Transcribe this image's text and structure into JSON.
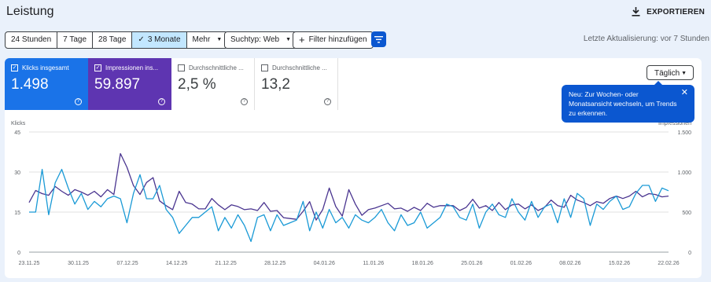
{
  "page": {
    "title": "Leistung"
  },
  "toolbar": {
    "export_label": "EXPORTIEREN",
    "export_icon": "download-icon"
  },
  "filters": {
    "ranges": [
      "24 Stunden",
      "7 Tage",
      "28 Tage",
      "3 Monate",
      "Mehr"
    ],
    "active_range": "3 Monate",
    "search_type": "Suchtyp: Web",
    "add_filter": "Filter hinzufügen",
    "last_update": "Letzte Aktualisierung: vor 7 Stunden"
  },
  "metrics": [
    {
      "label": "Klicks insgesamt",
      "value": "1.498",
      "checked": true,
      "color": "#1a73e8"
    },
    {
      "label": "Impressionen ins...",
      "value": "59.897",
      "checked": true,
      "color": "#5e35b1"
    },
    {
      "label": "Durchschnittliche ...",
      "value": "2,5 %",
      "checked": false
    },
    {
      "label": "Durchschnittliche ...",
      "value": "13,2",
      "checked": false
    }
  ],
  "granularity": {
    "selected": "Täglich"
  },
  "tooltip": {
    "text": "Neu: Zur Wochen- oder Monatsansicht wechseln, um Trends zu erkennen."
  },
  "chart_data": {
    "type": "line",
    "ylabel_left": "Klicks",
    "ylabel_right": "Impressionen",
    "ylim_left": [
      0,
      45
    ],
    "ylim_right": [
      0,
      1500
    ],
    "yticks_left": [
      "0",
      "15",
      "30",
      "45"
    ],
    "yticks_right": [
      "0",
      "500",
      "1.000",
      "1.500"
    ],
    "xticks": [
      "23.11.25",
      "30.11.25",
      "07.12.25",
      "14.12.25",
      "21.12.25",
      "28.12.25",
      "04.01.26",
      "11.01.26",
      "18.01.26",
      "25.01.26",
      "01.02.26",
      "08.02.26",
      "15.02.26",
      "22.02.26"
    ],
    "grid": true,
    "series": [
      {
        "name": "Klicks",
        "color": "#1a9ad6",
        "values": [
          15,
          15,
          31,
          14,
          26,
          31,
          24,
          18,
          22,
          16,
          19,
          17,
          20,
          21,
          20,
          11,
          22,
          29,
          20,
          20,
          25,
          16,
          13,
          7,
          10,
          13,
          13,
          15,
          17,
          8,
          13,
          9,
          14,
          10,
          4,
          13,
          14,
          8,
          14,
          10,
          11,
          12,
          19,
          8,
          15,
          9,
          16,
          11,
          13,
          9,
          14,
          12,
          11,
          13,
          16,
          11,
          8,
          14,
          10,
          11,
          15,
          9,
          11,
          13,
          18,
          17,
          13,
          12,
          18,
          9,
          15,
          18,
          14,
          13,
          20,
          15,
          12,
          19,
          13,
          17,
          18,
          11,
          20,
          13,
          22,
          20,
          10,
          18,
          16,
          19,
          21,
          16,
          17,
          22,
          25,
          25,
          19,
          24,
          23
        ]
      },
      {
        "name": "Impressionen",
        "color": "#4a3590",
        "values": [
          620,
          770,
          730,
          710,
          820,
          760,
          710,
          780,
          750,
          710,
          760,
          690,
          780,
          720,
          1230,
          1060,
          830,
          720,
          870,
          930,
          640,
          580,
          530,
          760,
          620,
          600,
          540,
          540,
          670,
          590,
          530,
          590,
          570,
          530,
          540,
          520,
          620,
          510,
          520,
          430,
          420,
          410,
          510,
          630,
          400,
          530,
          800,
          570,
          450,
          780,
          600,
          460,
          530,
          550,
          580,
          610,
          540,
          550,
          510,
          560,
          520,
          610,
          560,
          580,
          580,
          580,
          520,
          560,
          660,
          550,
          580,
          520,
          620,
          530,
          590,
          600,
          540,
          590,
          520,
          560,
          650,
          580,
          560,
          710,
          650,
          620,
          580,
          630,
          610,
          670,
          700,
          670,
          700,
          760,
          690,
          730,
          720,
          690,
          700
        ]
      }
    ]
  }
}
